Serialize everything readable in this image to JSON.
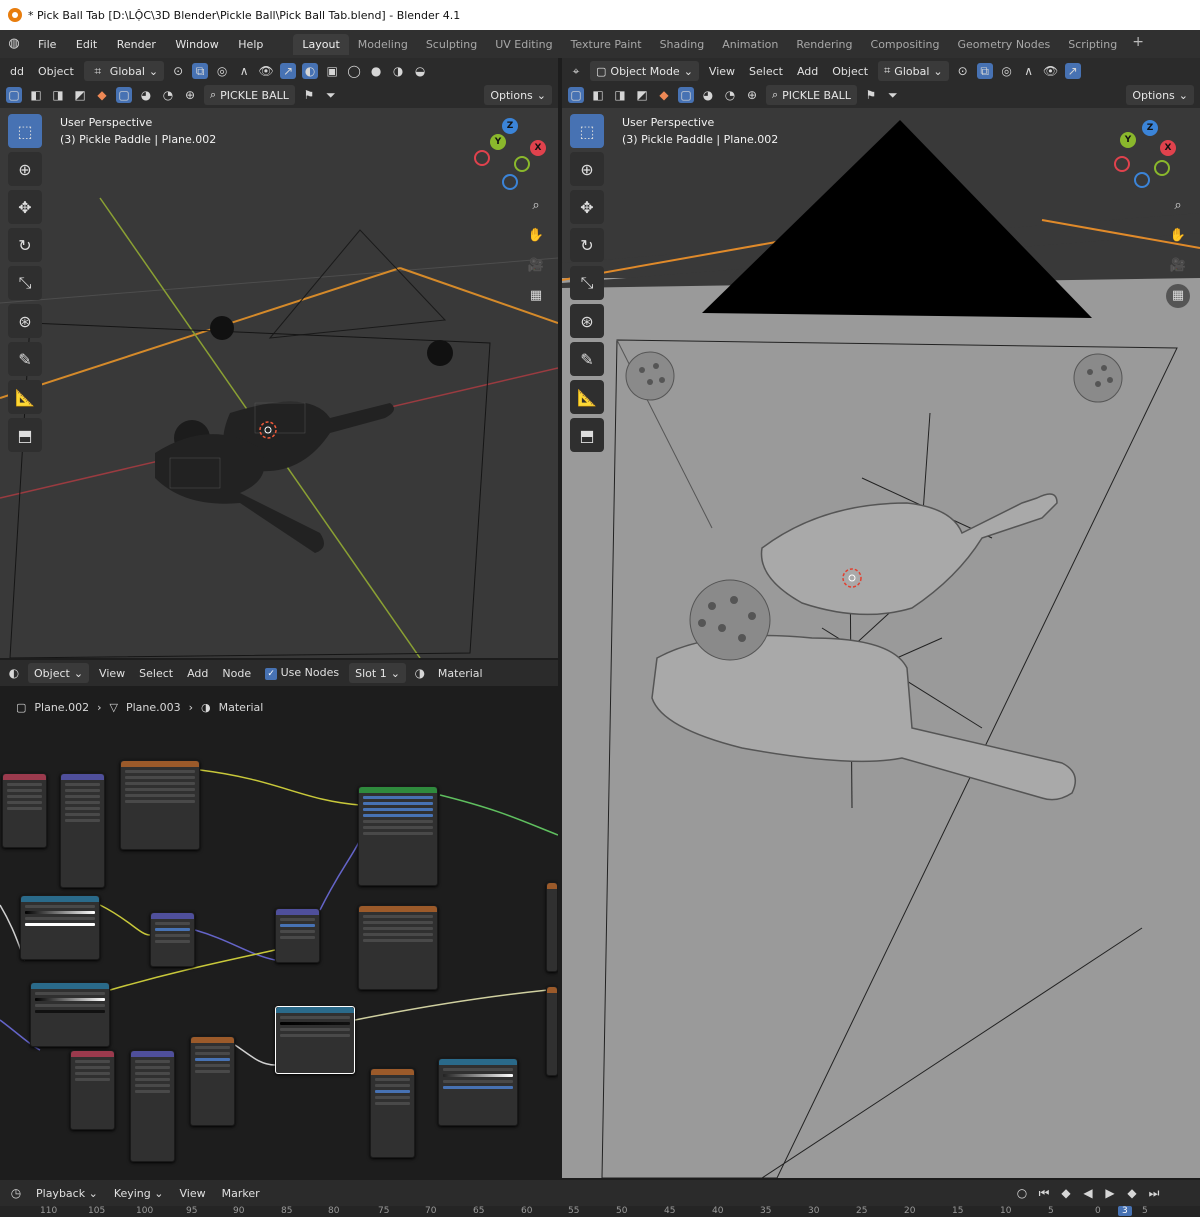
{
  "window": {
    "title": "* Pick Ball Tab [D:\\LỘC\\3D Blender\\Pickle Ball\\Pick Ball Tab.blend] - Blender 4.1"
  },
  "menu": [
    "File",
    "Edit",
    "Render",
    "Window",
    "Help"
  ],
  "workspaces": [
    "Layout",
    "Modeling",
    "Sculpting",
    "UV Editing",
    "Texture Paint",
    "Shading",
    "Animation",
    "Rendering",
    "Compositing",
    "Geometry Nodes",
    "Scripting"
  ],
  "viewport_left": {
    "header": {
      "add_partial": "dd",
      "object": "Object",
      "orientation": "Global"
    },
    "header2": {
      "collection": "PICKLE BALL",
      "options": "Options"
    },
    "overlay_label": "User Perspective",
    "overlay_sub": "(3) Pickle Paddle | Plane.002",
    "gizmo": {
      "z": "Z",
      "y": "Y",
      "x": "X"
    }
  },
  "viewport_right": {
    "header": {
      "mode": "Object Mode",
      "view": "View",
      "select": "Select",
      "add": "Add",
      "object": "Object",
      "orientation": "Global"
    },
    "header2": {
      "collection": "PICKLE BALL",
      "options": "Options"
    },
    "overlay_label": "User Perspective",
    "overlay_sub": "(3) Pickle Paddle | Plane.002",
    "gizmo": {
      "z": "Z",
      "y": "Y",
      "x": "X"
    }
  },
  "node_editor": {
    "header": {
      "object": "Object",
      "view": "View",
      "select": "Select",
      "add": "Add",
      "node": "Node",
      "use_nodes": "Use Nodes",
      "slot": "Slot 1",
      "material": "Material"
    },
    "breadcrumb": [
      "Plane.002",
      "Plane.003",
      "Material"
    ]
  },
  "timeline": {
    "playback": "Playback",
    "keying": "Keying",
    "view": "View",
    "marker": "Marker",
    "frames": [
      "110",
      "105",
      "100",
      "95",
      "90",
      "85",
      "80",
      "75",
      "70",
      "65",
      "60",
      "55",
      "50",
      "45",
      "40",
      "35",
      "30",
      "25",
      "20",
      "15",
      "10",
      "5",
      "0",
      "3",
      "5"
    ]
  },
  "colors": {
    "accent": "#4772b3",
    "orange": "#e87d0d",
    "x_axis": "#e0424d",
    "y_axis": "#8ab82c",
    "z_axis": "#3b84d8"
  }
}
